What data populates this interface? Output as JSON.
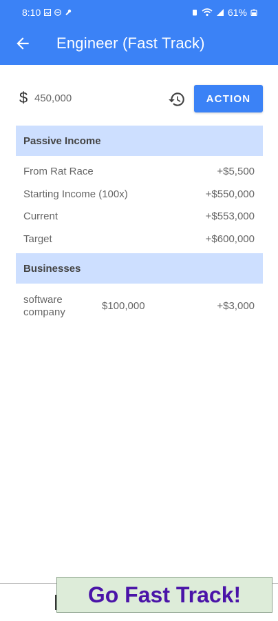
{
  "status": {
    "time": "8:10",
    "battery": "61%"
  },
  "app_bar": {
    "title": "Engineer (Fast Track)"
  },
  "cash": {
    "symbol": "$",
    "value": "450,000",
    "action_label": "ACTION"
  },
  "passive_income": {
    "header": "Passive Income",
    "rows": [
      {
        "label": "From Rat Race",
        "value": "+$5,500"
      },
      {
        "label": "Starting Income (100x)",
        "value": "+$550,000"
      },
      {
        "label": "Current",
        "value": "+$553,000"
      },
      {
        "label": "Target",
        "value": "+$600,000"
      }
    ]
  },
  "businesses": {
    "header": "Businesses",
    "items": [
      {
        "name": "software company",
        "cost": "$100,000",
        "income": "+$3,000"
      }
    ]
  },
  "footer": {
    "fast_track_label": "Go Fast Track!"
  },
  "colors": {
    "primary": "#3b82f6",
    "section_bg": "#cddfff",
    "fast_track_bg": "#ddecd9",
    "fast_track_text": "#4a14a8"
  }
}
